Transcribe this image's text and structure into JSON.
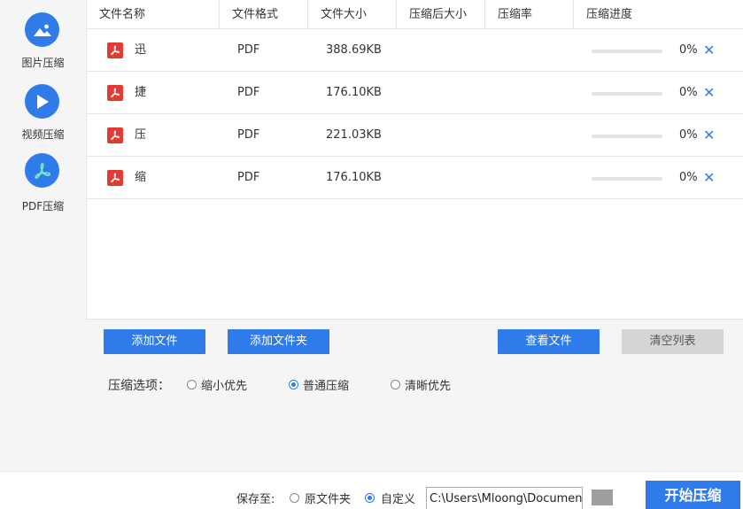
{
  "sidebar": {
    "items": [
      {
        "label": "图片压缩",
        "icon": "image-icon"
      },
      {
        "label": "视频压缩",
        "icon": "play-icon"
      },
      {
        "label": "PDF压缩",
        "icon": "pdf-icon"
      }
    ]
  },
  "table": {
    "headers": [
      "文件名称",
      "文件格式",
      "文件大小",
      "压缩后大小",
      "压缩率",
      "压缩进度"
    ],
    "rows": [
      {
        "name": "迅",
        "format": "PDF",
        "size": "388.69KB",
        "compressed": "",
        "ratio": "",
        "progress": "0%",
        "progress_value": 0
      },
      {
        "name": "捷",
        "format": "PDF",
        "size": "176.10KB",
        "compressed": "",
        "ratio": "",
        "progress": "0%",
        "progress_value": 0
      },
      {
        "name": "压",
        "format": "PDF",
        "size": "221.03KB",
        "compressed": "",
        "ratio": "",
        "progress": "0%",
        "progress_value": 0
      },
      {
        "name": "缩",
        "format": "PDF",
        "size": "176.10KB",
        "compressed": "",
        "ratio": "",
        "progress": "0%",
        "progress_value": 0
      }
    ],
    "close_glyph": "✕"
  },
  "actions": {
    "add_file": "添加文件",
    "add_folder": "添加文件夹",
    "view_files": "查看文件",
    "clear_list": "清空列表"
  },
  "options": {
    "label": "压缩选项：",
    "choices": [
      {
        "label": "缩小优先",
        "checked": false
      },
      {
        "label": "普通压缩",
        "checked": true
      },
      {
        "label": "清晰优先",
        "checked": false
      }
    ]
  },
  "footer": {
    "save_to": "保存至:",
    "original_folder": "原文件夹",
    "custom": "自定义",
    "custom_checked": true,
    "path": "C:\\Users\\Mloong\\Documents",
    "start": "开始压缩"
  },
  "colors": {
    "accent": "#2f7bea",
    "pdf_red": "#e23b36",
    "sidebar_bg": "#f5f5f5"
  }
}
